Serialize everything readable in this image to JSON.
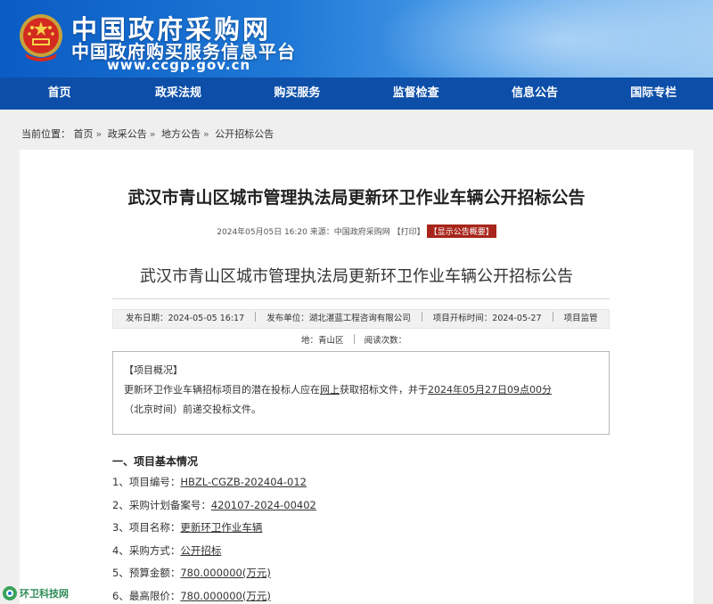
{
  "header": {
    "site_title": "中国政府采购网",
    "site_subtitle": "中国政府购买服务信息平台",
    "site_url": "www.ccgp.gov.cn"
  },
  "nav": [
    "首页",
    "政采法规",
    "购买服务",
    "监督检查",
    "信息公告",
    "国际专栏"
  ],
  "breadcrumb": {
    "label": "当前位置：",
    "items": [
      "首页",
      "政采公告",
      "地方公告",
      "公开招标公告"
    ]
  },
  "notice": {
    "title": "武汉市青山区城市管理执法局更新环卫作业车辆公开招标公告",
    "datetime": "2024年05月05日 16:20",
    "source_label": "来源：",
    "source": "中国政府采购网",
    "print": "【打印】",
    "summary_badge": "【显示公告概要】",
    "sub_title": "武汉市青山区城市管理执法局更新环卫作业车辆公开招标公告"
  },
  "info": {
    "publish_date_label": "发布日期：",
    "publish_date": "2024-05-05 16:17",
    "publisher_label": "发布单位：",
    "publisher": "湖北湛蓝工程咨询有限公司",
    "open_time_label": "项目开标时间：",
    "open_time": "2024-05-27",
    "location_label_a": "项目监管",
    "location_label_b": "地：",
    "location": "青山区",
    "reads_label": "阅读次数："
  },
  "summary": {
    "heading": "【项目概况】",
    "text_a": "更新环卫作业车辆招标项目的潜在投标人应在",
    "text_b": "网上",
    "text_c": "获取招标文件，并于",
    "text_d": "2024年05月27日09点00分",
    "text_e": "（北京时间）前递交投标文件。"
  },
  "section": {
    "heading": "一、项目基本情况",
    "items": [
      {
        "label": "1、项目编号：",
        "value": "HBZL-CGZB-202404-012"
      },
      {
        "label": "2、采购计划备案号：",
        "value": "420107-2024-00402"
      },
      {
        "label": "3、项目名称：",
        "value": "更新环卫作业车辆"
      },
      {
        "label": "4、采购方式：",
        "value": "公开招标"
      },
      {
        "label": "5、预算金额：",
        "value": "780.000000(万元)"
      },
      {
        "label": "6、最高限价：",
        "value": "780.000000(万元)"
      }
    ]
  },
  "watermark": {
    "text": "环卫科技网"
  }
}
